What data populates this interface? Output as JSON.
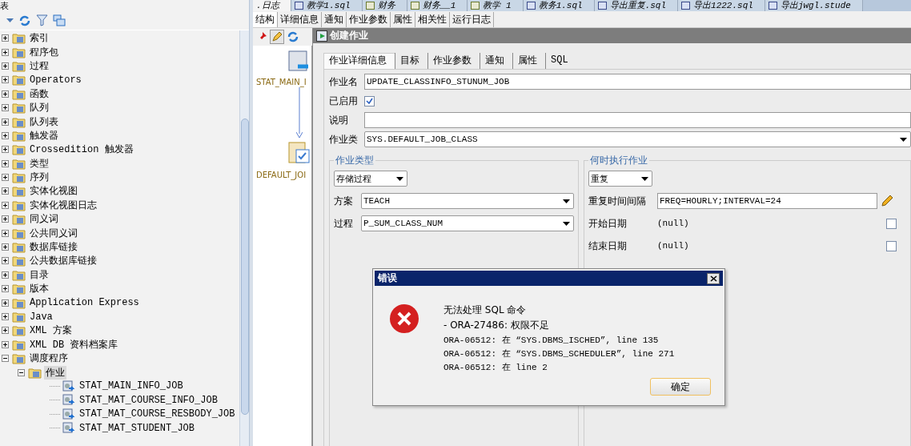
{
  "panel_title": "表",
  "tree": [
    {
      "label": "索引",
      "kind": "folder",
      "expanded": false,
      "selected": false
    },
    {
      "label": "程序包",
      "kind": "folder",
      "expanded": false,
      "selected": false
    },
    {
      "label": "过程",
      "kind": "folder",
      "expanded": false,
      "selected": false
    },
    {
      "label": "Operators",
      "kind": "folder",
      "expanded": false,
      "selected": false
    },
    {
      "label": "函数",
      "kind": "folder",
      "expanded": false,
      "selected": false
    },
    {
      "label": "队列",
      "kind": "folder",
      "expanded": false,
      "selected": false
    },
    {
      "label": "队列表",
      "kind": "folder",
      "expanded": false,
      "selected": false
    },
    {
      "label": "触发器",
      "kind": "folder",
      "expanded": false,
      "selected": false
    },
    {
      "label": "Crossedition 触发器",
      "kind": "folder",
      "expanded": false,
      "selected": false
    },
    {
      "label": "类型",
      "kind": "folder",
      "expanded": false,
      "selected": false
    },
    {
      "label": "序列",
      "kind": "folder",
      "expanded": false,
      "selected": false
    },
    {
      "label": "实体化视图",
      "kind": "folder",
      "expanded": false,
      "selected": false
    },
    {
      "label": "实体化视图日志",
      "kind": "folder",
      "expanded": false,
      "selected": false
    },
    {
      "label": "同义词",
      "kind": "folder",
      "expanded": false,
      "selected": false
    },
    {
      "label": "公共同义词",
      "kind": "folder",
      "expanded": false,
      "selected": false
    },
    {
      "label": "数据库链接",
      "kind": "folder",
      "expanded": false,
      "selected": false
    },
    {
      "label": "公共数据库链接",
      "kind": "folder",
      "expanded": false,
      "selected": false
    },
    {
      "label": "目录",
      "kind": "folder",
      "expanded": false,
      "selected": false
    },
    {
      "label": "版本",
      "kind": "folder",
      "expanded": false,
      "selected": false
    },
    {
      "label": "Application Express",
      "kind": "folder",
      "expanded": false,
      "selected": false
    },
    {
      "label": "Java",
      "kind": "folder",
      "expanded": false,
      "selected": false
    },
    {
      "label": "XML 方案",
      "kind": "folder",
      "expanded": false,
      "selected": false
    },
    {
      "label": "XML DB 资料档案库",
      "kind": "folder",
      "expanded": false,
      "selected": false
    },
    {
      "label": "调度程序",
      "kind": "folder",
      "expanded": true,
      "selected": false,
      "children": [
        {
          "label": "作业",
          "kind": "folder",
          "expanded": true,
          "selected": true,
          "children": [
            {
              "label": "STAT_MAIN_INFO_JOB",
              "kind": "job",
              "selected": false
            },
            {
              "label": "STAT_MAT_COURSE_INFO_JOB",
              "kind": "job",
              "selected": false
            },
            {
              "label": "STAT_MAT_COURSE_RESBODY_JOB",
              "kind": "job",
              "selected": false
            },
            {
              "label": "STAT_MAT_STUDENT_JOB",
              "kind": "job",
              "selected": false
            }
          ]
        }
      ]
    }
  ],
  "doc_tabs": [
    {
      "label": ".日志",
      "kind": "log",
      "selected": true
    },
    {
      "label": "教学1.sql",
      "kind": "file",
      "selected": false
    },
    {
      "label": "财务",
      "kind": "sql",
      "selected": false
    },
    {
      "label": "财务__1",
      "kind": "sql",
      "selected": false
    },
    {
      "label": "教学 1",
      "kind": "sql",
      "selected": false
    },
    {
      "label": "教务1.sql",
      "kind": "file",
      "selected": false
    },
    {
      "label": "导出重复.sql",
      "kind": "file",
      "selected": false
    },
    {
      "label": "导出1222.sql",
      "kind": "file",
      "selected": false
    },
    {
      "label": "导出jwgl.stude",
      "kind": "file",
      "selected": false
    }
  ],
  "sub_tabs": [
    {
      "label": "结构",
      "selected": true
    },
    {
      "label": "详细信息",
      "selected": false
    },
    {
      "label": "通知",
      "selected": false
    },
    {
      "label": "作业参数",
      "selected": false
    },
    {
      "label": "属性",
      "selected": false
    },
    {
      "label": "相关性",
      "selected": false
    },
    {
      "label": "运行日志",
      "selected": false
    }
  ],
  "diagram": {
    "nodes": [
      {
        "label": "STAT_MAIN_I"
      },
      {
        "label": "DEFAULT_JOI"
      }
    ]
  },
  "dialog": {
    "title": "创建作业",
    "tabs": [
      {
        "label": "作业详细信息",
        "selected": true
      },
      {
        "label": "目标",
        "selected": false
      },
      {
        "label": "作业参数",
        "selected": false
      },
      {
        "label": "通知",
        "selected": false
      },
      {
        "label": "属性",
        "selected": false
      },
      {
        "label": "SQL",
        "selected": false
      }
    ],
    "job_name": {
      "label": "作业名",
      "value": "UPDATE_CLASSINFO_STUNUM_JOB"
    },
    "enabled": {
      "label": "已启用",
      "checked": true
    },
    "description": {
      "label": "说明"
    },
    "job_class": {
      "label": "作业类",
      "value": "SYS.DEFAULT_JOB_CLASS"
    },
    "job_type": {
      "title": "作业类型",
      "type": "存储过程",
      "schema": {
        "label": "方案",
        "value": "TEACH"
      },
      "procedure": {
        "label": "过程",
        "value": "P_SUM_CLASS_NUM"
      }
    },
    "schedule": {
      "title": "何时执行作业",
      "mode": "重复",
      "interval": {
        "label": "重复时间间隔",
        "value": "FREQ=HOURLY;INTERVAL=24"
      },
      "start": {
        "label": "开始日期",
        "value": "(null)",
        "checked": false
      },
      "end": {
        "label": "结束日期",
        "value": "(null)",
        "checked": false
      }
    }
  },
  "error_dialog": {
    "title": "错误",
    "lines": [
      "无法处理 SQL 命令",
      "- ORA-27486: 权限不足",
      "ORA-06512: 在 “SYS.DBMS_ISCHED”, line 135",
      "ORA-06512: 在 “SYS.DBMS_SCHEDULER”, line 271",
      "ORA-06512: 在 line 2"
    ],
    "ok": "确定"
  }
}
